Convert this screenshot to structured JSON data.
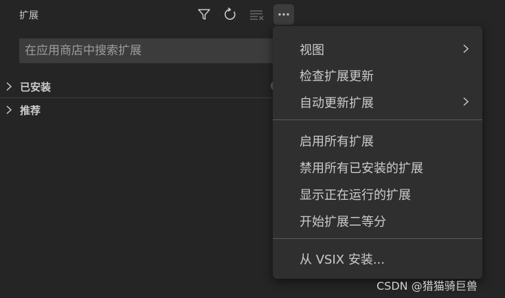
{
  "header": {
    "title": "扩展",
    "toolbar": [
      {
        "icon": "filter-icon"
      },
      {
        "icon": "refresh-icon"
      },
      {
        "icon": "clear-list-icon"
      },
      {
        "icon": "more-icon"
      }
    ]
  },
  "search": {
    "placeholder": "在应用商店中搜索扩展",
    "value": ""
  },
  "sections": [
    {
      "label": "已安装",
      "expanded": false
    },
    {
      "label": "推荐",
      "expanded": false
    }
  ],
  "menu": {
    "items": [
      {
        "label": "视图",
        "submenu": true
      },
      {
        "label": "检查扩展更新",
        "submenu": false
      },
      {
        "label": "自动更新扩展",
        "submenu": true
      },
      {
        "label": "启用所有扩展",
        "submenu": false
      },
      {
        "label": "禁用所有已安装的扩展",
        "submenu": false
      },
      {
        "label": "显示正在运行的扩展",
        "submenu": false
      },
      {
        "label": "开始扩展二等分",
        "submenu": false
      },
      {
        "label": "从 VSIX 安装...",
        "submenu": false
      }
    ]
  },
  "watermark": "CSDN @猎猫骑巨兽",
  "colors": {
    "background": "#252526",
    "input": "#3c3c3c",
    "menu": "#2f2f30",
    "text": "#cccccc"
  }
}
